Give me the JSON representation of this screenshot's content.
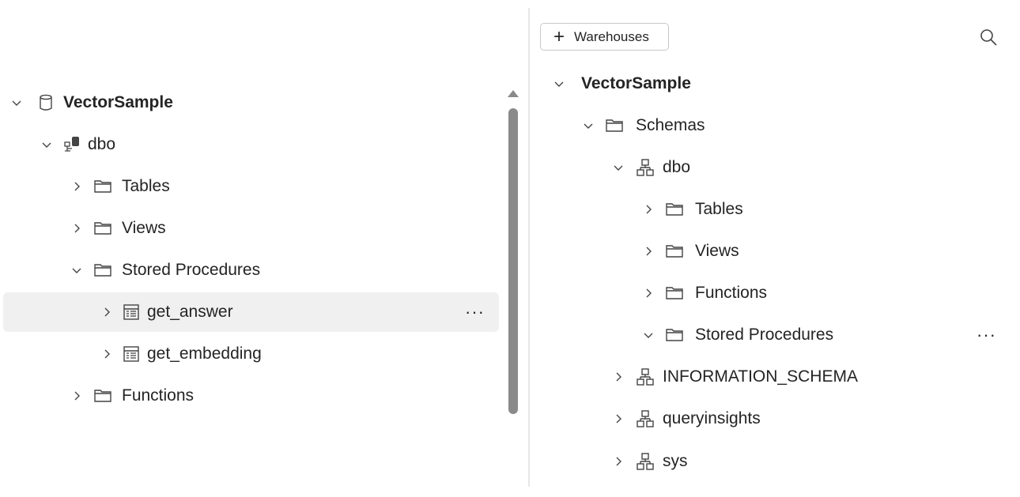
{
  "left_tree": {
    "root": {
      "label": "VectorSample",
      "icon": "database-icon"
    },
    "schema": {
      "label": "dbo",
      "icon": "schema-icon"
    },
    "folders": {
      "tables": "Tables",
      "views": "Views",
      "stored_procedures": "Stored Procedures",
      "functions": "Functions"
    },
    "procedures": [
      {
        "label": "get_answer"
      },
      {
        "label": "get_embedding"
      }
    ],
    "more_label": "···"
  },
  "right_panel": {
    "add_button_label": "Warehouses",
    "add_button_plus": "+",
    "root": {
      "label": "VectorSample"
    },
    "schemas_folder": "Schemas",
    "dbo": "dbo",
    "folders": {
      "tables": "Tables",
      "views": "Views",
      "functions": "Functions",
      "stored_procedures": "Stored Procedures"
    },
    "other_schemas": [
      "INFORMATION_SCHEMA",
      "queryinsights",
      "sys"
    ],
    "more_label": "···"
  },
  "colors": {
    "text": "#242424",
    "hover": "#f0f0f0",
    "scrollbar": "#8a8a8a"
  }
}
